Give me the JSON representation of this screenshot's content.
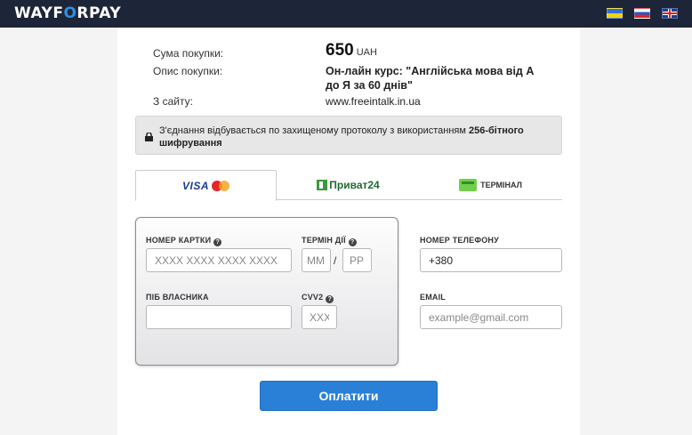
{
  "header": {
    "logo_left": "WAYF",
    "logo_accent": "O",
    "logo_right": "RPAY",
    "languages": [
      "ua",
      "ru",
      "en"
    ]
  },
  "purchase": {
    "amount_label": "Сума покупки:",
    "amount_value": "650",
    "currency": "UAH",
    "description_label": "Опис покупки:",
    "description_value": "Он-лайн курс: \"Англійська мова від А до Я за 60 днів\"",
    "site_label": "З сайту:",
    "site_value": "www.freeintalk.in.ua"
  },
  "security": {
    "text": "З'єднання відбувається по захищеному протоколу з використанням ",
    "bold_text": "256-бітного шифрування"
  },
  "tabs": {
    "visa": "VISA",
    "privat": "Приват24",
    "terminal": "ТЕРМІНАЛ"
  },
  "card_form": {
    "card_number_label": "НОМЕР КАРТКИ",
    "card_number_placeholder": "XXXX XXXX XXXX XXXX",
    "expiry_label": "ТЕРМІН ДІЇ",
    "month_placeholder": "MM",
    "year_placeholder": "PP",
    "expiry_separator": "/",
    "holder_label": "ПІБ ВЛАСНИКА",
    "cvv_label": "CVV2",
    "cvv_placeholder": "XXX",
    "help_glyph": "?"
  },
  "contact": {
    "phone_label": "НОМЕР ТЕЛЕФОНУ",
    "phone_value": "+380",
    "email_label": "EMAIL",
    "email_placeholder": "example@gmail.com"
  },
  "pay_button": "Оплатити",
  "colors": {
    "topbar": "#1d2538",
    "accent": "#2f8fe0",
    "pay_button": "#2a80d6"
  }
}
